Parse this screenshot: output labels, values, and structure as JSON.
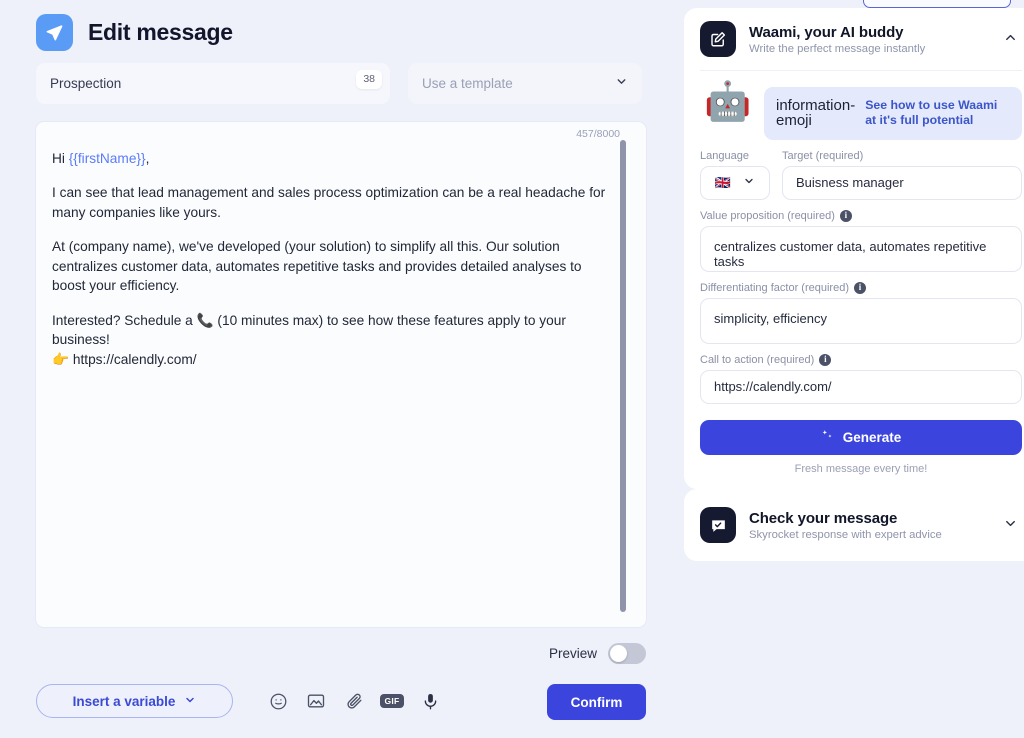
{
  "header": {
    "title": "Edit message",
    "app_icon": "send-paper-plane-icon"
  },
  "subject": {
    "value": "Prospection",
    "char_badge": "38"
  },
  "template": {
    "placeholder": "Use a template",
    "chevron": "chevron-down-icon"
  },
  "editor": {
    "counter": "457/8000",
    "greeting_prefix": "Hi ",
    "variable_token": "{{firstName}}",
    "greeting_suffix": ",",
    "paragraph_2": "I can see that lead management and sales process optimization can be a real headache for many companies like yours.",
    "paragraph_3": "At (company name), we've developed (your solution) to simplify all this. Our solution centralizes customer data, automates repetitive tasks and provides detailed analyses to boost your efficiency.",
    "paragraph_4": "Interested? Schedule a 📞 (10 minutes max) to see how these features apply to your business!",
    "paragraph_5": "👉 https://calendly.com/"
  },
  "preview": {
    "label": "Preview",
    "state": "off"
  },
  "bottom": {
    "insert_variable": "Insert a variable",
    "insert_variable_chevron": "chevron-down-icon",
    "icons": [
      "emoji-smiley-icon",
      "image-icon",
      "paperclip-icon",
      "gif-icon",
      "microphone-icon"
    ],
    "gif_label": "GIF",
    "confirm": "Confirm"
  },
  "waami": {
    "title": "Waami, your AI buddy",
    "subtitle": "Write the perfect message instantly",
    "icon": "edit-square-icon",
    "collapse_chevron": "chevron-up-icon",
    "robot_emoji": "🤖",
    "banner": {
      "icon": "information-emoji",
      "text": "See how to use Waami at it's full potential"
    },
    "language": {
      "label": "Language",
      "flag": "🇬🇧",
      "chevron": "chevron-down-icon"
    },
    "target": {
      "label": "Target (required)",
      "value": "Buisness manager"
    },
    "value_proposition": {
      "label": "Value proposition (required)",
      "info": "i",
      "value": "centralizes customer data, automates repetitive tasks"
    },
    "differentiating_factor": {
      "label": "Differentiating factor (required)",
      "info": "i",
      "value": "simplicity, efficiency"
    },
    "call_to_action": {
      "label": "Call to action (required)",
      "info": "i",
      "value": "https://calendly.com/"
    },
    "generate": {
      "label": "Generate",
      "icon": "sparkles-icon",
      "note": "Fresh message every time!"
    }
  },
  "check_message": {
    "title": "Check your message",
    "subtitle": "Skyrocket response with expert advice",
    "icon": "chat-check-icon",
    "expand_chevron": "chevron-down-icon"
  },
  "colors": {
    "accent": "#3b45dd",
    "app_badge": "#5a9bf6",
    "variable": "#5b7cfa",
    "banner_bg": "#e4eafc",
    "page_bg": "#eef1f9"
  }
}
